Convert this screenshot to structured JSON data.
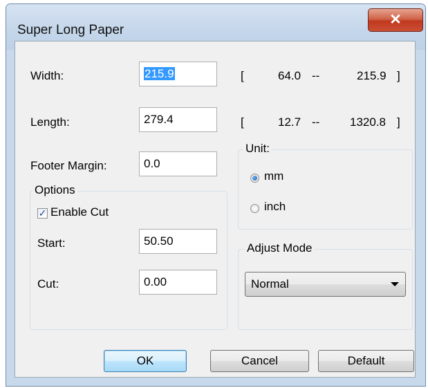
{
  "window": {
    "title": "Super Long Paper",
    "close_symbol": "✕"
  },
  "width": {
    "label": "Width:",
    "value": "215.9",
    "range_open": "[",
    "min": "64.0",
    "dash": "--",
    "max": "215.9",
    "range_close": "]"
  },
  "length": {
    "label": "Length:",
    "value": "279.4",
    "range_open": "[",
    "min": "12.7",
    "dash": "--",
    "max": "1320.8",
    "range_close": "]"
  },
  "footer_margin": {
    "label": "Footer Margin:",
    "value": "0.0"
  },
  "unit": {
    "legend": "Unit:",
    "options": [
      "mm",
      "inch"
    ],
    "selected": "mm"
  },
  "options": {
    "legend": "Options",
    "enable_cut": {
      "label": "Enable Cut",
      "checked": true
    },
    "start": {
      "label": "Start:",
      "value": "50.50"
    },
    "cut": {
      "label": "Cut:",
      "value": "0.00"
    }
  },
  "adjust_mode": {
    "legend": "Adjust Mode",
    "selected": "Normal"
  },
  "buttons": {
    "ok": "OK",
    "cancel": "Cancel",
    "default": "Default"
  }
}
